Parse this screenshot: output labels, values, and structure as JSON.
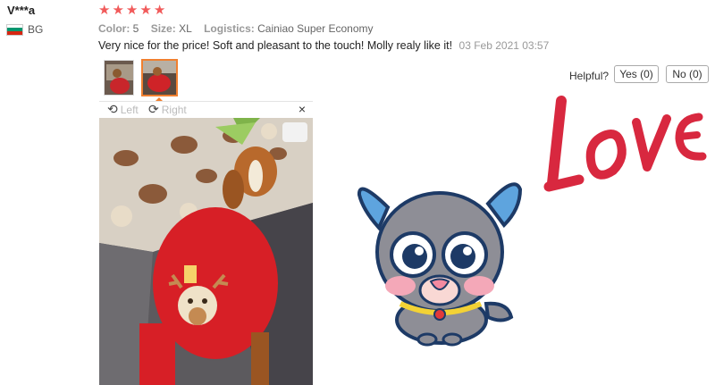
{
  "reviewer": {
    "name": "V***a",
    "country_code": "BG"
  },
  "rating": {
    "stars": 5,
    "max": 5,
    "color": "#f15a5a"
  },
  "attributes": {
    "color_label": "Color:",
    "color_value": "5",
    "size_label": "Size:",
    "size_value": "XL",
    "logistics_label": "Logistics:",
    "logistics_value": "Cainiao Super Economy"
  },
  "review": {
    "text": "Very nice for the price! Soft and pleasant to the touch! Molly realy like it!",
    "date": "03 Feb 2021 03:57"
  },
  "viewer": {
    "rotate_left": "Left",
    "rotate_right": "Right",
    "close": "×"
  },
  "helpful": {
    "label": "Helpful?",
    "yes": "Yes (0)",
    "no": "No (0)"
  },
  "sticker": {
    "text": "LOVE",
    "color": "#d8283f"
  },
  "colors": {
    "accent": "#f08030",
    "sweater": "#d71f26"
  }
}
